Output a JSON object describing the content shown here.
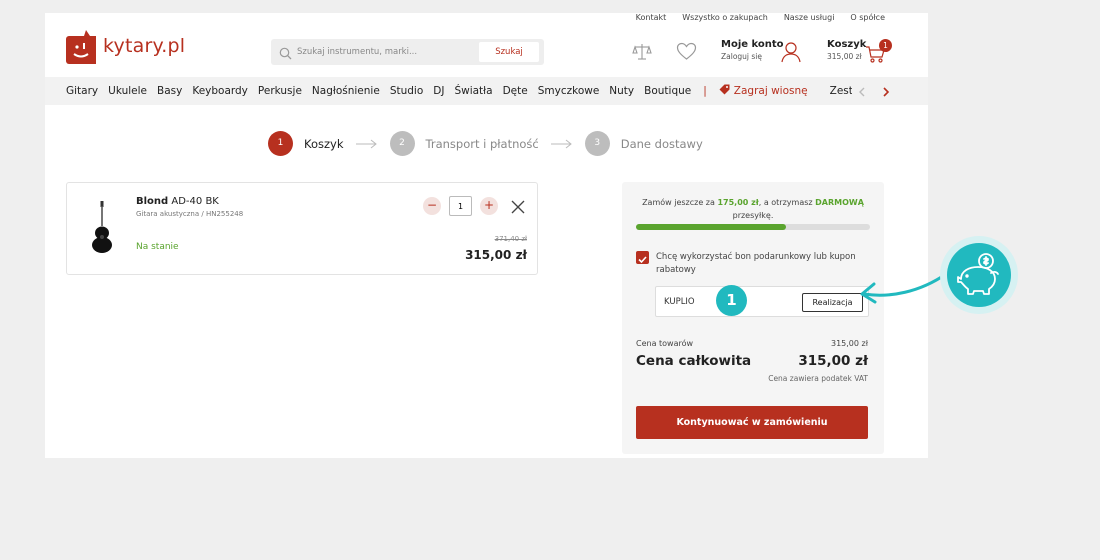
{
  "toplinks": [
    "Kontakt",
    "Wszystko o zakupach",
    "Nasze usługi",
    "O spółce"
  ],
  "logo": {
    "text": "kytary.pl"
  },
  "search": {
    "placeholder": "Szukaj instrumentu, marki...",
    "button_label": "Szukaj"
  },
  "account": {
    "title": "Moje konto",
    "subtitle": "Zaloguj się"
  },
  "cart": {
    "title": "Koszyk",
    "amount": "315,00 zł",
    "count": "1"
  },
  "nav": {
    "items": [
      "Gitary",
      "Ukulele",
      "Basy",
      "Keyboardy",
      "Perkusje",
      "Nagłośnienie",
      "Studio",
      "DJ",
      "Światła",
      "Dęte",
      "Smyczkowe",
      "Nuty",
      "Boutique"
    ],
    "separator": "|",
    "promo": "Zagraj wiosnę",
    "last": "Zestaw"
  },
  "steps": [
    {
      "num": "1",
      "label": "Koszyk"
    },
    {
      "num": "2",
      "label": "Transport i płatność"
    },
    {
      "num": "3",
      "label": "Dane dostawy"
    }
  ],
  "product": {
    "brand": "Blond",
    "model": "AD-40 BK",
    "subtitle": "Gitara akustyczna / HN255248",
    "stock": "Na stanie",
    "quantity": "1",
    "old_price": "371,40 zł",
    "price": "315,00 zł"
  },
  "summary": {
    "freeship_prefix": "Zamów jeszcze za ",
    "freeship_amount": "175,00 zł",
    "freeship_mid": ", a otrzymasz ",
    "freeship_word": "DARMOWĄ",
    "freeship_suffix": " przesyłkę.",
    "progress": 0.64,
    "coupon_label": "Chcę wykorzystać bon podarunkowy lub kupon rabatowy",
    "coupon_value": "KUPLIO",
    "coupon_button": "Realizacja",
    "goods_label": "Cena towarów",
    "goods_value": "315,00 zł",
    "total_label": "Cena całkowita",
    "total_value": "315,00 zł",
    "vat_note": "Cena zawiera podatek VAT",
    "cta": "Kontynuować w zamówieniu"
  },
  "annotation": {
    "badge": "1"
  },
  "colors": {
    "brand": "#b7301f",
    "accent": "#21b9bf",
    "green": "#5aa42e"
  }
}
